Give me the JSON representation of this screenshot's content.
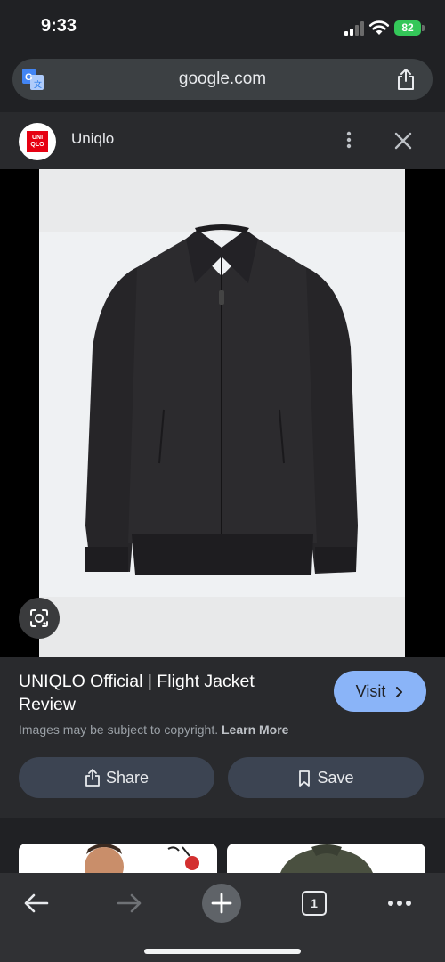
{
  "status": {
    "time": "9:33",
    "battery": "82"
  },
  "browser": {
    "url": "google.com"
  },
  "header": {
    "site_name": "Uniqlo",
    "logo_text": "UNI QLO"
  },
  "result": {
    "title": "UNIQLO Official | Flight Jacket Review",
    "visit_label": "Visit",
    "copyright_text": "Images may be subject to copyright.",
    "learn_more_label": "Learn More",
    "share_label": "Share",
    "save_label": "Save"
  },
  "toolbar": {
    "tab_count": "1"
  },
  "colors": {
    "accent": "#8ab4f8",
    "button_bg": "#3c4452",
    "sheet_bg": "#292a2d",
    "brand_red": "#e60012"
  },
  "icons": [
    "translate-icon",
    "share-icon",
    "more-vert-icon",
    "close-icon",
    "lens-icon",
    "bookmark-icon",
    "back-icon",
    "forward-icon",
    "new-tab-icon",
    "tabs-icon",
    "more-horiz-icon"
  ]
}
